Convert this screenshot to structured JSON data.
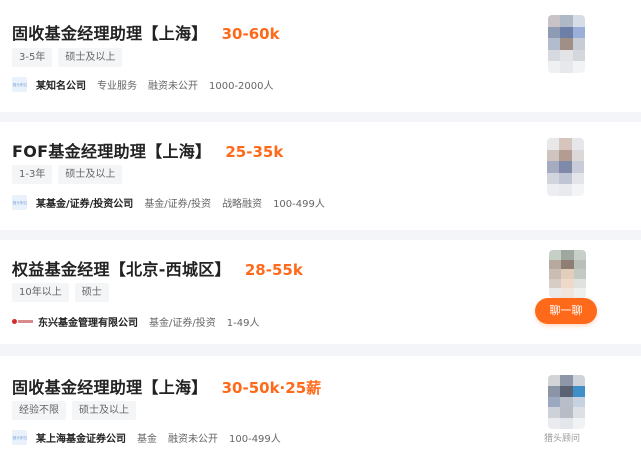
{
  "jobs": [
    {
      "title": "固收基金经理助理【上海】",
      "salary": "30-60k",
      "tags": [
        "3-5年",
        "硕士及以上"
      ],
      "logo_text": "猎头职位",
      "company": "某知名公司",
      "meta": [
        "专业服务",
        "融资未公开",
        "1000-2000人"
      ]
    },
    {
      "title": "FOF基金经理助理【上海】",
      "salary": "25-35k",
      "tags": [
        "1-3年",
        "硕士及以上"
      ],
      "logo_text": "猎头职位",
      "company": "某基金/证券/投资公司",
      "meta": [
        "基金/证券/投资",
        "战略融资",
        "100-499人"
      ]
    },
    {
      "title": "权益基金经理【北京-西城区】",
      "salary": "28-55k",
      "tags": [
        "10年以上",
        "硕士"
      ],
      "logo_text": "",
      "company": "东兴基金管理有限公司",
      "meta": [
        "基金/证券/投资",
        "1-49人"
      ]
    },
    {
      "title": "固收基金经理助理【上海】",
      "salary": "30-50k·25薪",
      "tags": [
        "经验不限",
        "硕士及以上"
      ],
      "logo_text": "猎头职位",
      "company": "某上海基金证券公司",
      "meta": [
        "基金",
        "融资未公开",
        "100-499人"
      ]
    }
  ],
  "chat_button": "聊一聊",
  "headhunter_label": "猎头顾问",
  "colors": {
    "salary": "#ff6a1a",
    "background": "#f3f5f8",
    "card": "#ffffff"
  }
}
